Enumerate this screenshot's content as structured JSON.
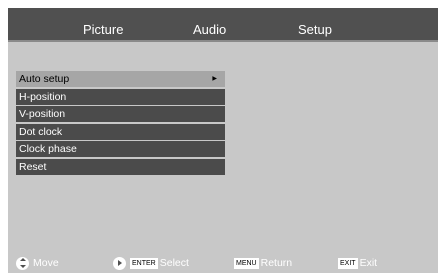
{
  "tabs": [
    {
      "label": "Picture"
    },
    {
      "label": "Audio"
    },
    {
      "label": "Setup"
    }
  ],
  "active_tab": "Setup",
  "menu": {
    "items": [
      {
        "label": "Auto setup",
        "selected": true,
        "has_submenu": true
      },
      {
        "label": "H-position"
      },
      {
        "label": "V-position"
      },
      {
        "label": "Dot clock"
      },
      {
        "label": "Clock phase"
      },
      {
        "label": "Reset"
      }
    ]
  },
  "footer": {
    "move_label": "Move",
    "enter_key": "ENTER",
    "select_label": "Select",
    "menu_key": "MENU",
    "return_label": "Return",
    "exit_key": "EXIT",
    "exit_label": "Exit"
  },
  "colors": {
    "tab_bar": "#505050",
    "screen_background": "#c8c8c8",
    "menu_item": "#4b4b4b",
    "menu_item_selected": "#a6a6a6"
  }
}
